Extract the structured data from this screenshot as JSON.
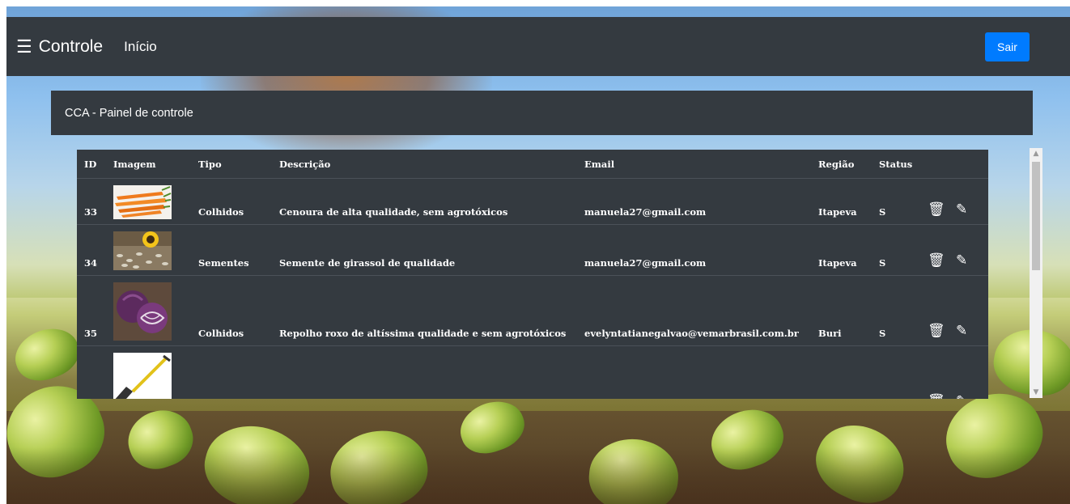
{
  "navbar": {
    "menu_icon": "hamburger-icon",
    "brand": "Controle",
    "home_link": "Início",
    "logout_button": "Sair",
    "colors": {
      "bar": "#343a40",
      "button": "#007bff"
    }
  },
  "panel": {
    "title": "CCA - Painel de controle"
  },
  "table": {
    "headers": {
      "id": "ID",
      "image": "Imagem",
      "type": "Tipo",
      "description": "Descrição",
      "email": "Email",
      "region": "Região",
      "status": "Status"
    },
    "rows": [
      {
        "id": "33",
        "image": "carrots-thumbnail",
        "type": "Colhidos",
        "description": "Cenoura de alta qualidade, sem agrotóxicos",
        "email": "manuela27@gmail.com",
        "region": "Itapeva",
        "status": "S"
      },
      {
        "id": "34",
        "image": "sunflower-seeds-thumbnail",
        "type": "Sementes",
        "description": "Semente de girassol de qualidade",
        "email": "manuela27@gmail.com",
        "region": "Itapeva",
        "status": "S"
      },
      {
        "id": "35",
        "image": "red-cabbage-thumbnail",
        "type": "Colhidos",
        "description": "Repolho roxo de altíssima qualidade e sem agrotóxicos",
        "email": "evelyntatianegalvao@vemarbrasil.com.br",
        "region": "Buri",
        "status": "S"
      },
      {
        "id": "",
        "image": "shovel-thumbnail",
        "type": "",
        "description": "",
        "email": "",
        "region": "",
        "status": ""
      }
    ],
    "actions": {
      "delete_icon": "trash-icon",
      "edit_icon": "edit-icon"
    }
  }
}
